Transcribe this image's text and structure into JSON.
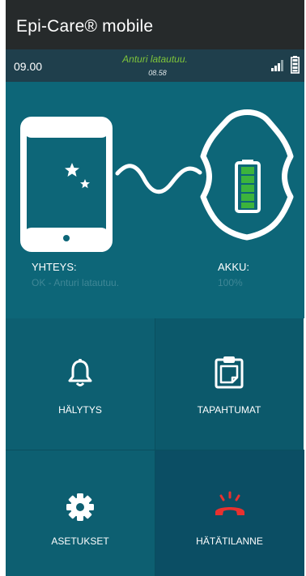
{
  "app": {
    "title": "Epi-Care® mobile"
  },
  "status": {
    "time": "09.00",
    "message": "Anturi latautuu.",
    "message_time": "08.58"
  },
  "hero": {
    "connection_label": "YHTEYS:",
    "connection_value": "OK - Anturi latautuu.",
    "battery_label": "AKKU:",
    "battery_value": "100%"
  },
  "tiles": [
    {
      "label": "HÄLYTYS",
      "icon": "bell-icon"
    },
    {
      "label": "TAPAHTUMAT",
      "icon": "clipboard-icon"
    },
    {
      "label": "ASETUKSET",
      "icon": "gear-icon"
    },
    {
      "label": "HÄTÄTILANNE",
      "icon": "emergency-phone-icon"
    }
  ],
  "colors": {
    "header": "#262a2b",
    "status_bar": "#1f3f4c",
    "hero": "#0d6678",
    "status_message": "#7ec43a",
    "battery_green": "#3cb43c",
    "emergency_red": "#e8312f"
  }
}
